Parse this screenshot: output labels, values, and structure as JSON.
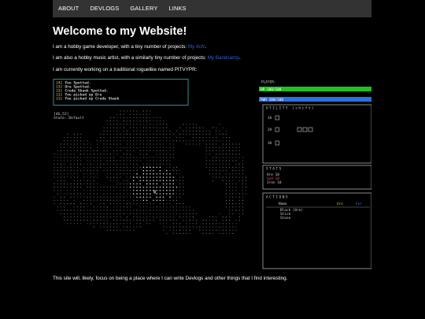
{
  "nav": {
    "items": [
      {
        "label": "ABOUT"
      },
      {
        "label": "DEVLOGS"
      },
      {
        "label": "GALLERY"
      },
      {
        "label": "LINKS"
      }
    ]
  },
  "main": {
    "title": "Welcome to my Website!",
    "para1_text": "I am a hobby game developer, with a tiny number of projects: ",
    "para1_link": "My Itch!",
    "para1_end": ".",
    "para2_text": "I am also a hobby music artist, with a similarly tiny number of projects: ",
    "para2_link": "My Bandcamp",
    "para2_end": ".",
    "para3_text": "I am currently working on a traditional roguelike named PITVYPR:",
    "footer_text": "This site will, likely, focus on being a place where I can write Devlogs and other things that I find interesting."
  },
  "game": {
    "log": [
      {
        "n": "[4]",
        "text": "You Spotted."
      },
      {
        "n": "[3]",
        "text": "Ore Spotted."
      },
      {
        "n": "[2]",
        "text": "Crude Shank Spotted."
      },
      {
        "n": "[1]",
        "text": "You picked up Ore"
      },
      {
        "n": "[1]",
        "text": "You picked up Crude Shank"
      }
    ],
    "coords": "[46,52]",
    "state": "State: Default",
    "player_label": "PLAYER:",
    "hp_text": "HP 100/100",
    "hp_fraction": 1.0,
    "pwr_text": "PWR 100/100",
    "pwr_fraction": 1.0,
    "utility_title": "UTILITY (shift)",
    "slots": [
      "1H",
      "2H",
      "3H"
    ],
    "stats_title": "STATS",
    "stats": [
      "Ore 10",
      "Sod 10",
      "Iron 10"
    ],
    "actions_title": "ACTIONS",
    "actions_header": {
      "name": "Name",
      "col1": "Ore",
      "col2": "For"
    },
    "actions_items": [
      "Black (Ore)",
      "Stick",
      "Stone"
    ],
    "colors": {
      "hp": "#20c020",
      "pwr": "#2a70e0",
      "log_border": "#2e8f8f",
      "log_num": "#c0a040"
    }
  }
}
